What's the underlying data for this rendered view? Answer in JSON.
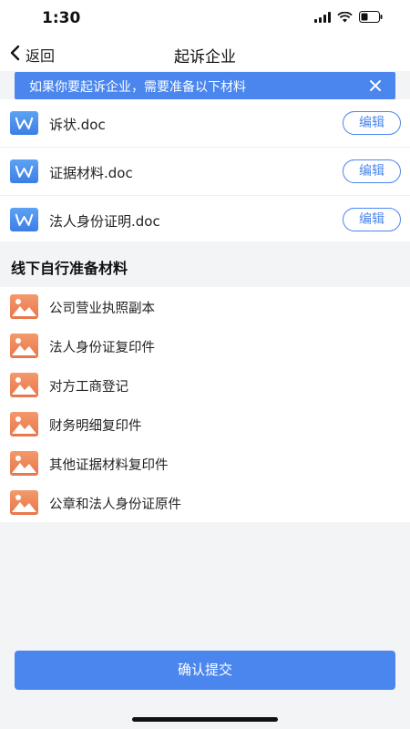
{
  "status_bar": {
    "time": "1:30"
  },
  "nav": {
    "back_label": "返回",
    "title": "起诉企业"
  },
  "notice": {
    "text": "如果你要起诉企业，需要准备以下材料"
  },
  "documents": [
    {
      "name": "诉状.doc",
      "action": "编辑"
    },
    {
      "name": "证据材料.doc",
      "action": "编辑"
    },
    {
      "name": "法人身份证明.doc",
      "action": "编辑"
    }
  ],
  "offline": {
    "title": "线下自行准备材料",
    "items": [
      "公司营业执照副本",
      "法人身份证复印件",
      "对方工商登记",
      "财务明细复印件",
      "其他证据材料复印件",
      "公章和法人身份证原件"
    ]
  },
  "submit": {
    "label": "确认提交"
  },
  "colors": {
    "accent": "#4a86ee",
    "image_icon": "#ec8157",
    "word_icon": "#4f92ef"
  }
}
